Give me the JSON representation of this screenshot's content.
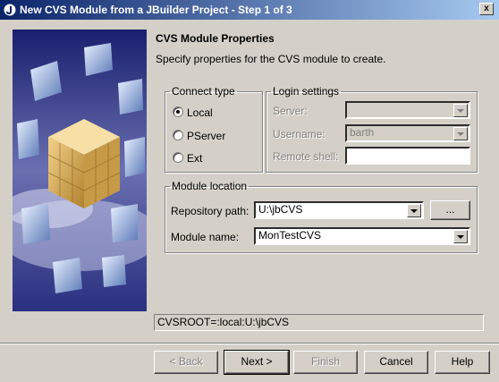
{
  "window": {
    "title": "New CVS Module from a JBuilder Project - Step 1 of 3",
    "close_glyph": "x"
  },
  "header": {
    "title": "CVS Module Properties",
    "subtitle": "Specify properties for the CVS module to create."
  },
  "connect_type": {
    "legend": "Connect type",
    "options": [
      {
        "label": "Local",
        "selected": true
      },
      {
        "label": "PServer",
        "selected": false
      },
      {
        "label": "Ext",
        "selected": false
      }
    ]
  },
  "login": {
    "legend": "Login settings",
    "server_label": "Server:",
    "server_value": "",
    "username_label": "Username:",
    "username_value": "barth",
    "remote_shell_label": "Remote shell:",
    "remote_shell_value": ""
  },
  "module_location": {
    "legend": "Module location",
    "repo_label": "Repository path:",
    "repo_value": "U:\\jbCVS",
    "browse_label": "...",
    "module_label": "Module name:",
    "module_value": "MonTestCVS"
  },
  "status": {
    "cvsroot": "CVSROOT=:local:U:\\jbCVS"
  },
  "buttons": {
    "back": "< Back",
    "next": "Next >",
    "finish": "Finish",
    "cancel": "Cancel",
    "help": "Help"
  }
}
